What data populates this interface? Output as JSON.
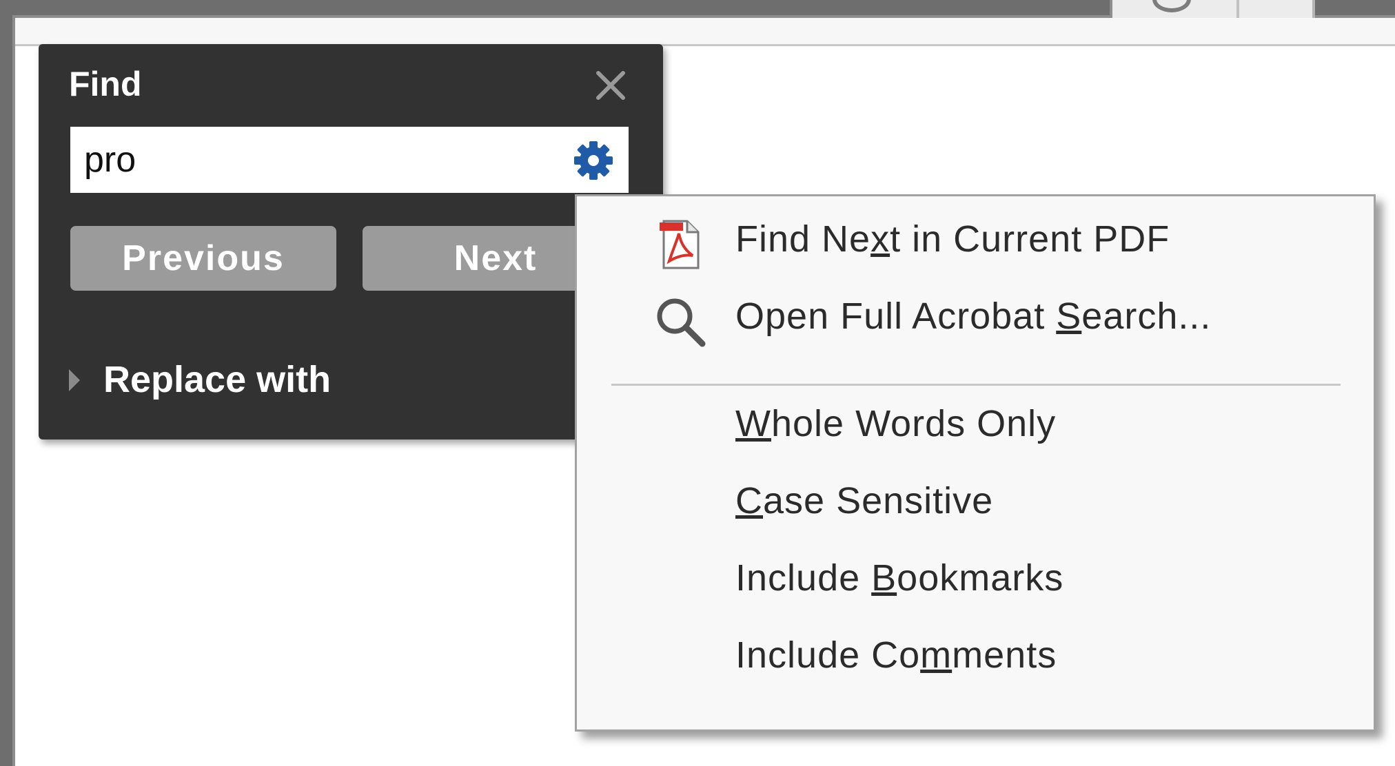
{
  "find_panel": {
    "title": "Find",
    "search": {
      "value": "pro",
      "placeholder": ""
    },
    "previous_label": "Previous",
    "next_label": "Next",
    "replace_label": "Replace with"
  },
  "menu": {
    "items": [
      {
        "icon": "pdf-icon",
        "before": "Find Ne",
        "key": "x",
        "after": "t in Current PDF"
      },
      {
        "icon": "search-icon",
        "before": "Open Full Acrobat ",
        "key": "S",
        "after": "earch..."
      },
      {
        "before": "",
        "key": "W",
        "after": "hole Words Only"
      },
      {
        "before": "",
        "key": "C",
        "after": "ase Sensitive"
      },
      {
        "before": "Include ",
        "key": "B",
        "after": "ookmarks"
      },
      {
        "before": "Include Co",
        "key": "m",
        "after": "ments"
      }
    ]
  },
  "colors": {
    "panel_bg": "#323232",
    "button_bg": "#9b9b9b",
    "gear_blue": "#1f5ba8",
    "menu_bg": "#f8f8f8",
    "pdf_red": "#d8322a"
  }
}
